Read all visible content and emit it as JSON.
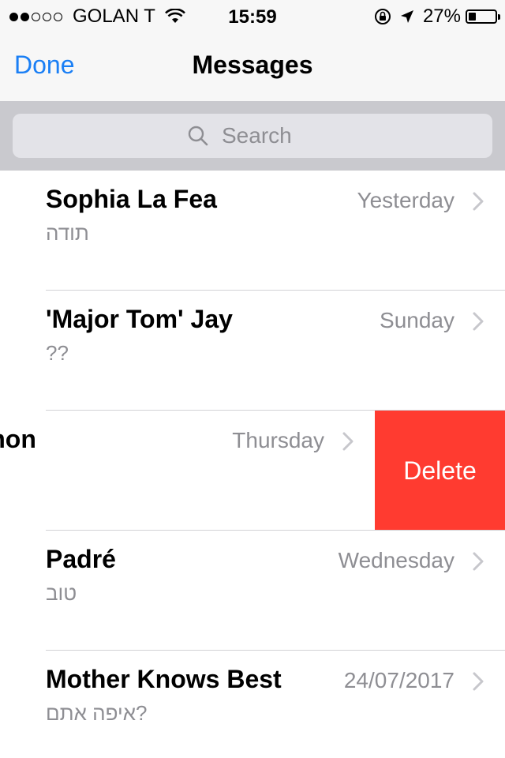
{
  "status_bar": {
    "carrier": "GOLAN T",
    "time": "15:59",
    "battery_percent": "27%",
    "battery_level": 0.27
  },
  "nav": {
    "done_label": "Done",
    "title": "Messages"
  },
  "search": {
    "placeholder": "Search"
  },
  "conversations": [
    {
      "name": "Sophia La Fea",
      "preview": "תודה",
      "date": "Yesterday"
    },
    {
      "name": "'Major Tom' Jay",
      "preview": "??",
      "date": "Sunday"
    },
    {
      "name": "admon",
      "preview": "",
      "date": "Thursday",
      "delete_label": "Delete"
    },
    {
      "name": "Padré",
      "preview": "טוב",
      "date": "Wednesday"
    },
    {
      "name": "Mother Knows Best",
      "preview": "?איפה אתם",
      "date": "24/07/2017"
    }
  ],
  "colors": {
    "accent": "#1a7ff5",
    "delete": "#ff3b30",
    "secondary_text": "#8e8e93"
  }
}
